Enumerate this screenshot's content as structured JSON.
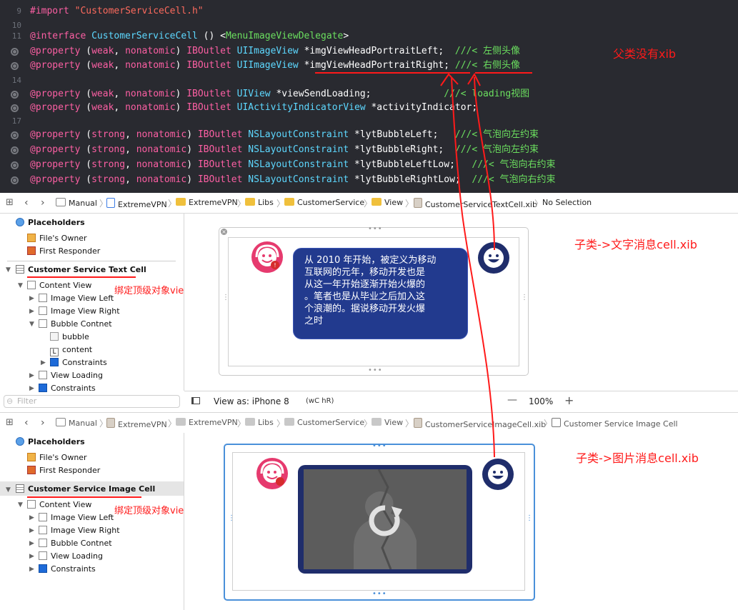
{
  "code": {
    "lines": [
      {
        "num": "9",
        "tokens": [
          {
            "t": "#import ",
            "c": "kw"
          },
          {
            "t": "\"CustomerServiceCell.h\"",
            "c": "str"
          }
        ]
      },
      {
        "num": "10",
        "tokens": []
      },
      {
        "num": "11",
        "tokens": [
          {
            "t": "@interface ",
            "c": "kw"
          },
          {
            "t": "CustomerServiceCell",
            "c": "cls"
          },
          {
            "t": " () <",
            "c": "pl"
          },
          {
            "t": "MenuImageViewDelegate",
            "c": "cmt"
          },
          {
            "t": ">",
            "c": "pl"
          }
        ]
      },
      {
        "num": "",
        "dot": true,
        "tokens": [
          {
            "t": "@property ",
            "c": "kw"
          },
          {
            "t": "(",
            "c": "pl"
          },
          {
            "t": "weak",
            "c": "kw"
          },
          {
            "t": ", ",
            "c": "pl"
          },
          {
            "t": "nonatomic",
            "c": "kw"
          },
          {
            "t": ") ",
            "c": "pl"
          },
          {
            "t": "IBOutlet ",
            "c": "kw"
          },
          {
            "t": "UIImageView ",
            "c": "cls"
          },
          {
            "t": "*imgViewHeadPortraitLeft;  ",
            "c": "pl"
          },
          {
            "t": "///< 左侧头像",
            "c": "cmt"
          }
        ]
      },
      {
        "num": "",
        "dot": true,
        "tokens": [
          {
            "t": "@property ",
            "c": "kw"
          },
          {
            "t": "(",
            "c": "pl"
          },
          {
            "t": "weak",
            "c": "kw"
          },
          {
            "t": ", ",
            "c": "pl"
          },
          {
            "t": "nonatomic",
            "c": "kw"
          },
          {
            "t": ") ",
            "c": "pl"
          },
          {
            "t": "IBOutlet ",
            "c": "kw"
          },
          {
            "t": "UIImageView ",
            "c": "cls"
          },
          {
            "t": "*imgViewHeadPortraitRight; ",
            "c": "pl"
          },
          {
            "t": "///< 右侧头像",
            "c": "cmt"
          }
        ]
      },
      {
        "num": "14",
        "tokens": []
      },
      {
        "num": "",
        "dot": true,
        "tokens": [
          {
            "t": "@property ",
            "c": "kw"
          },
          {
            "t": "(",
            "c": "pl"
          },
          {
            "t": "weak",
            "c": "kw"
          },
          {
            "t": ", ",
            "c": "pl"
          },
          {
            "t": "nonatomic",
            "c": "kw"
          },
          {
            "t": ") ",
            "c": "pl"
          },
          {
            "t": "IBOutlet ",
            "c": "kw"
          },
          {
            "t": "UIView ",
            "c": "cls"
          },
          {
            "t": "*viewSendLoading;             ",
            "c": "pl"
          },
          {
            "t": "///< loading视图",
            "c": "cmt"
          }
        ]
      },
      {
        "num": "",
        "dot": true,
        "tokens": [
          {
            "t": "@property ",
            "c": "kw"
          },
          {
            "t": "(",
            "c": "pl"
          },
          {
            "t": "weak",
            "c": "kw"
          },
          {
            "t": ", ",
            "c": "pl"
          },
          {
            "t": "nonatomic",
            "c": "kw"
          },
          {
            "t": ") ",
            "c": "pl"
          },
          {
            "t": "IBOutlet ",
            "c": "kw"
          },
          {
            "t": "UIActivityIndicatorView ",
            "c": "cls"
          },
          {
            "t": "*activityIndicator;",
            "c": "pl"
          }
        ]
      },
      {
        "num": "17",
        "tokens": []
      },
      {
        "num": "",
        "dot": true,
        "tokens": [
          {
            "t": "@property ",
            "c": "kw"
          },
          {
            "t": "(",
            "c": "pl"
          },
          {
            "t": "strong",
            "c": "kw"
          },
          {
            "t": ", ",
            "c": "pl"
          },
          {
            "t": "nonatomic",
            "c": "kw"
          },
          {
            "t": ") ",
            "c": "pl"
          },
          {
            "t": "IBOutlet ",
            "c": "kw"
          },
          {
            "t": "NSLayoutConstraint ",
            "c": "cls"
          },
          {
            "t": "*lytBubbleLeft;   ",
            "c": "pl"
          },
          {
            "t": "///< 气泡向左约束",
            "c": "cmt"
          }
        ]
      },
      {
        "num": "",
        "dot": true,
        "tokens": [
          {
            "t": "@property ",
            "c": "kw"
          },
          {
            "t": "(",
            "c": "pl"
          },
          {
            "t": "strong",
            "c": "kw"
          },
          {
            "t": ", ",
            "c": "pl"
          },
          {
            "t": "nonatomic",
            "c": "kw"
          },
          {
            "t": ") ",
            "c": "pl"
          },
          {
            "t": "IBOutlet ",
            "c": "kw"
          },
          {
            "t": "NSLayoutConstraint ",
            "c": "cls"
          },
          {
            "t": "*lytBubbleRight;  ",
            "c": "pl"
          },
          {
            "t": "///< 气泡向左约束",
            "c": "cmt"
          }
        ]
      },
      {
        "num": "",
        "dot": true,
        "tokens": [
          {
            "t": "@property ",
            "c": "kw"
          },
          {
            "t": "(",
            "c": "pl"
          },
          {
            "t": "strong",
            "c": "kw"
          },
          {
            "t": ", ",
            "c": "pl"
          },
          {
            "t": "nonatomic",
            "c": "kw"
          },
          {
            "t": ") ",
            "c": "pl"
          },
          {
            "t": "IBOutlet ",
            "c": "kw"
          },
          {
            "t": "NSLayoutConstraint ",
            "c": "cls"
          },
          {
            "t": "*lytBubbleLeftLow;   ",
            "c": "pl"
          },
          {
            "t": "///< 气泡向右约束",
            "c": "cmt"
          }
        ]
      },
      {
        "num": "",
        "dot": true,
        "tokens": [
          {
            "t": "@property ",
            "c": "kw"
          },
          {
            "t": "(",
            "c": "pl"
          },
          {
            "t": "strong",
            "c": "kw"
          },
          {
            "t": ", ",
            "c": "pl"
          },
          {
            "t": "nonatomic",
            "c": "kw"
          },
          {
            "t": ") ",
            "c": "pl"
          },
          {
            "t": "IBOutlet ",
            "c": "kw"
          },
          {
            "t": "NSLayoutConstraint ",
            "c": "cls"
          },
          {
            "t": "*lytBubbleRightLow;  ",
            "c": "pl"
          },
          {
            "t": "///< 气泡向右约束",
            "c": "cmt"
          }
        ]
      }
    ]
  },
  "annotations": {
    "parent_no_xib": "父类没有xib",
    "text_cell_xib": "子类->文字消息cell.xib",
    "image_cell_xib": "子类->图片消息cell.xib",
    "bind_top_view_1": "绑定顶级对象view",
    "bind_top_view_2": "绑定顶级对象view"
  },
  "pane1": {
    "jumpbar": [
      "Manual",
      "ExtremeVPN",
      "ExtremeVPN",
      "Libs",
      "CustomerService",
      "View",
      "CustomerServiceTextCell.xib",
      "No Selection"
    ],
    "outline": {
      "placeholders": "Placeholders",
      "files_owner": "File's Owner",
      "first_responder": "First Responder",
      "root": "Customer Service Text Cell",
      "content_view": "Content View",
      "image_view_left": "Image View Left",
      "image_view_right": "Image View Right",
      "bubble_contnet": "Bubble Contnet",
      "bubble": "bubble",
      "content": "content",
      "constraints_inner": "Constraints",
      "view_loading": "View Loading",
      "constraints": "Constraints"
    },
    "bubble_text": [
      "从 2010 年开始，被定义为移动",
      "互联网的元年，移动开发也是",
      "从这一年开始逐渐开始火爆的",
      "。笔者也是从毕业之后加入这",
      "个浪潮的。据说移动开发火爆",
      "之时"
    ],
    "filter_placeholder": "Filter",
    "view_as": "View as: iPhone 8",
    "size_class": "(wC hR)",
    "zoom": "100%"
  },
  "pane2": {
    "jumpbar": [
      "Manual",
      "ExtremeVPN",
      "ExtremeVPN",
      "Libs",
      "CustomerService",
      "View",
      "CustomerServiceImageCell.xib",
      "Customer Service Image Cell"
    ],
    "outline": {
      "placeholders": "Placeholders",
      "files_owner": "File's Owner",
      "first_responder": "First Responder",
      "root": "Customer Service Image Cell",
      "content_view": "Content View",
      "image_view_left": "Image View Left",
      "image_view_right": "Image View Right",
      "bubble_contnet": "Bubble Contnet",
      "view_loading": "View Loading",
      "constraints": "Constraints"
    }
  },
  "colors": {
    "editor_bg": "#292a30",
    "annotation_red": "#ff1a1a",
    "bubble_blue": "#223a8e",
    "avatar_pink": "#e63a6e",
    "avatar_navy": "#1f2d6b"
  }
}
